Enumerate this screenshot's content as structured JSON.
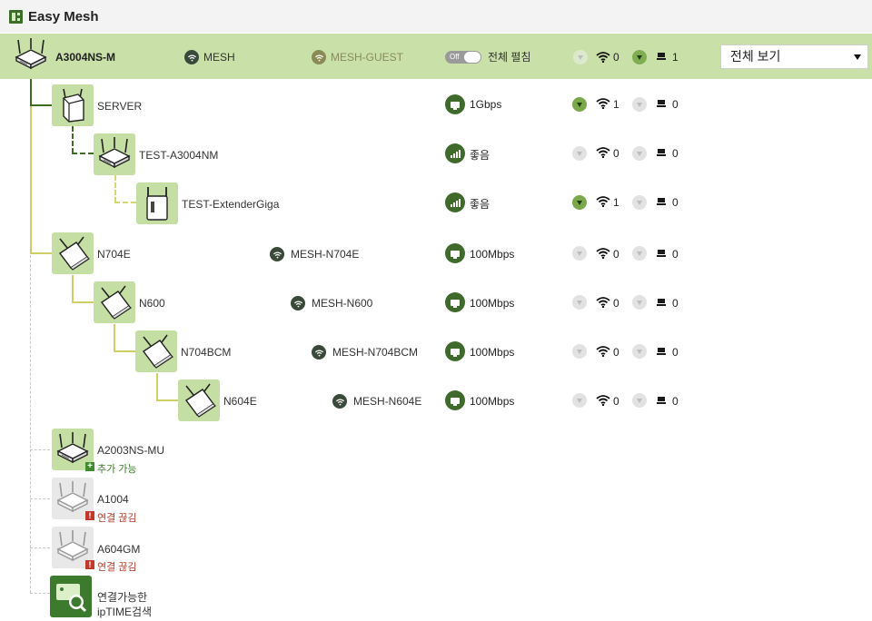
{
  "app": {
    "title": "Easy Mesh"
  },
  "root": {
    "name": "A3004NS-M",
    "ssid": "MESH",
    "guest_ssid": "MESH-GUEST",
    "toggle_state": "Off",
    "expand_all_label": "전체 펼침",
    "wifi_count": "0",
    "pc_count": "1",
    "view_select_value": "전체 보기"
  },
  "nodes": [
    {
      "name": "SERVER",
      "ssid": "",
      "link": "1Gbps",
      "wifi": "1",
      "pc": "0"
    },
    {
      "name": "TEST-A3004NM",
      "ssid": "",
      "link": "좋음",
      "wifi": "0",
      "pc": "0"
    },
    {
      "name": "TEST-ExtenderGiga",
      "ssid": "",
      "link": "좋음",
      "wifi": "1",
      "pc": "0"
    },
    {
      "name": "N704E",
      "ssid": "MESH-N704E",
      "link": "100Mbps",
      "wifi": "0",
      "pc": "0"
    },
    {
      "name": "N600",
      "ssid": "MESH-N600",
      "link": "100Mbps",
      "wifi": "0",
      "pc": "0"
    },
    {
      "name": "N704BCM",
      "ssid": "MESH-N704BCM",
      "link": "100Mbps",
      "wifi": "0",
      "pc": "0"
    },
    {
      "name": "N604E",
      "ssid": "MESH-N604E",
      "link": "100Mbps",
      "wifi": "0",
      "pc": "0"
    }
  ],
  "pending": [
    {
      "name": "A2003NS-MU",
      "status": "추가 가능"
    },
    {
      "name": "A1004",
      "status": "연결 끊김"
    },
    {
      "name": "A604GM",
      "status": "연결 끊김"
    }
  ],
  "search": {
    "line1": "연결가능한",
    "line2": "ipTIME검색"
  },
  "colors": {
    "accent": "#3d6b1f",
    "header_bg": "#c9e0a8",
    "tile_bg": "#c5dea3",
    "yellow_line": "#cfcf67",
    "warn": "#c0392b"
  },
  "icons": {
    "wifi": "wifi-icon",
    "pc": "pc-icon",
    "router": "router-icon",
    "extender": "extender-icon",
    "wired": "wired-link-icon",
    "signal": "signal-bars-icon",
    "search": "search-device-icon"
  }
}
